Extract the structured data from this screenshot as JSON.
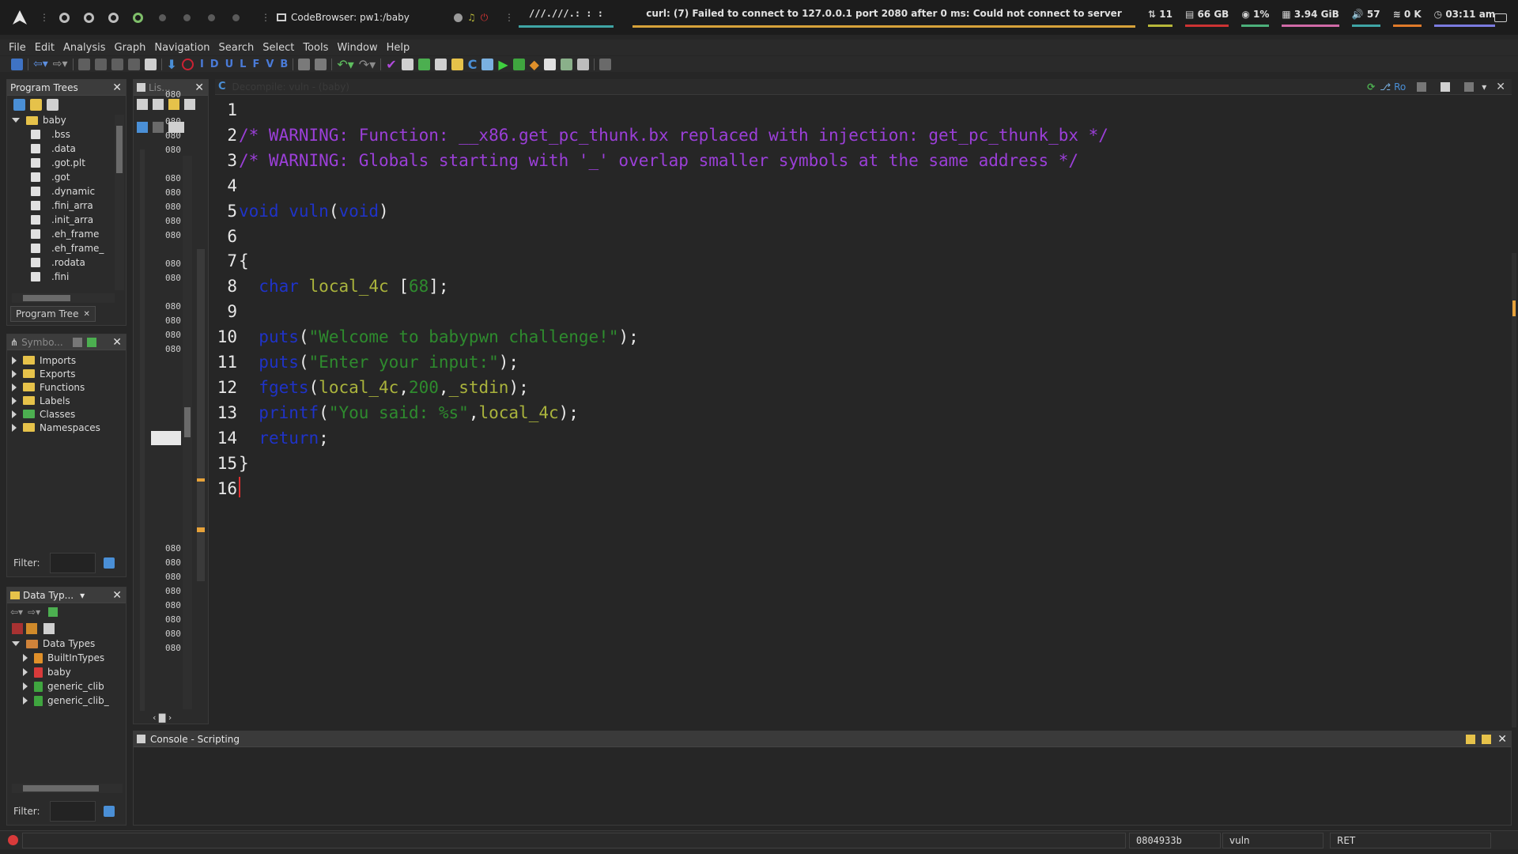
{
  "sysbar": {
    "logo_icon": "arch-logo-icon",
    "window_title": "CodeBrowser: pw1:/baby",
    "path_text": "///.///.:  : :",
    "notification": "curl: (7) Failed to connect to 127.0.0.1 port 2080 after 0 ms: Could not connect to server",
    "modules": [
      {
        "icon": "updates-icon",
        "glyph": "⇅",
        "value": "11",
        "color": "#b8b83a"
      },
      {
        "icon": "disk-icon",
        "glyph": "▤",
        "value": "66 GB",
        "color": "#cc3333"
      },
      {
        "icon": "cpu-icon",
        "glyph": "◉",
        "value": "1%",
        "color": "#4caf7a"
      },
      {
        "icon": "memory-icon",
        "glyph": "▦",
        "value": "3.94 GiB",
        "color": "#d06aa6"
      },
      {
        "icon": "volume-icon",
        "glyph": "🔊",
        "value": "57",
        "color": "#3fa5a5"
      },
      {
        "icon": "wifi-icon",
        "glyph": "≋",
        "value": "0 K",
        "color": "#e07a2a"
      },
      {
        "icon": "clock-icon",
        "glyph": "◷",
        "value": "03:11 am",
        "color": "#7b7be0"
      }
    ]
  },
  "menu": [
    "File",
    "Edit",
    "Analysis",
    "Graph",
    "Navigation",
    "Search",
    "Select",
    "Tools",
    "Window",
    "Help"
  ],
  "toolbar": {
    "letters": [
      {
        "t": "I",
        "c": "#4a7bd8"
      },
      {
        "t": "D",
        "c": "#4a7bd8"
      },
      {
        "t": "U",
        "c": "#4a7bd8"
      },
      {
        "t": "L",
        "c": "#4a7bd8"
      },
      {
        "t": "F",
        "c": "#4a7bd8"
      },
      {
        "t": "V",
        "c": "#4a7bd8"
      },
      {
        "t": "B",
        "c": "#4a7bd8"
      }
    ]
  },
  "program_trees": {
    "title": "Program Trees",
    "root": "baby",
    "items": [
      ".bss",
      ".data",
      ".got.plt",
      ".got",
      ".dynamic",
      ".fini_arra",
      ".init_arra",
      ".eh_frame",
      ".eh_frame_",
      ".rodata",
      ".fini"
    ],
    "tab": "Program Tree"
  },
  "symbol_tree": {
    "title": "Symbo...",
    "items": [
      "Imports",
      "Exports",
      "Functions",
      "Labels",
      "Classes",
      "Namespaces"
    ],
    "filter_label": "Filter:"
  },
  "data_types": {
    "title": "Data Typ...",
    "root": "Data Types",
    "items": [
      "BuiltInTypes",
      "baby",
      "generic_clib",
      "generic_clib_"
    ],
    "filter_label": "Filter:"
  },
  "listing": {
    "title": "Lis...",
    "addr_prefix": "080"
  },
  "decompiler": {
    "title": "Decompile: vuln - (baby)",
    "toolbar_label": "Ro",
    "lines": [
      {
        "n": "1",
        "parts": []
      },
      {
        "n": "2",
        "parts": [
          {
            "c": "cmt",
            "t": "/* WARNING: Function: __x86.get_pc_thunk.bx replaced with injection: get_pc_thunk_bx */"
          }
        ]
      },
      {
        "n": "3",
        "parts": [
          {
            "c": "cmt",
            "t": "/* WARNING: Globals starting with '_' overlap smaller symbols at the same address */"
          }
        ]
      },
      {
        "n": "4",
        "parts": []
      },
      {
        "n": "5",
        "parts": [
          {
            "c": "kw",
            "t": "void"
          },
          {
            "c": "pl",
            "t": " "
          },
          {
            "c": "kw",
            "t": "vuln"
          },
          {
            "c": "pl",
            "t": "("
          },
          {
            "c": "kw",
            "t": "void"
          },
          {
            "c": "pl",
            "t": ")"
          }
        ]
      },
      {
        "n": "6",
        "parts": []
      },
      {
        "n": "7",
        "parts": [
          {
            "c": "pl",
            "t": "{"
          }
        ]
      },
      {
        "n": "8",
        "parts": [
          {
            "c": "pl",
            "t": "  "
          },
          {
            "c": "kw",
            "t": "char"
          },
          {
            "c": "pl",
            "t": " "
          },
          {
            "c": "id",
            "t": "local_4c"
          },
          {
            "c": "pl",
            "t": " ["
          },
          {
            "c": "num",
            "t": "68"
          },
          {
            "c": "pl",
            "t": "];"
          }
        ]
      },
      {
        "n": "9",
        "parts": []
      },
      {
        "n": "10",
        "parts": [
          {
            "c": "pl",
            "t": "  "
          },
          {
            "c": "kw",
            "t": "puts"
          },
          {
            "c": "pl",
            "t": "("
          },
          {
            "c": "str",
            "t": "\"Welcome to babypwn challenge!\""
          },
          {
            "c": "pl",
            "t": ");"
          }
        ]
      },
      {
        "n": "11",
        "parts": [
          {
            "c": "pl",
            "t": "  "
          },
          {
            "c": "kw",
            "t": "puts"
          },
          {
            "c": "pl",
            "t": "("
          },
          {
            "c": "str",
            "t": "\"Enter your input:\""
          },
          {
            "c": "pl",
            "t": ");"
          }
        ]
      },
      {
        "n": "12",
        "parts": [
          {
            "c": "pl",
            "t": "  "
          },
          {
            "c": "kw",
            "t": "fgets"
          },
          {
            "c": "pl",
            "t": "("
          },
          {
            "c": "id",
            "t": "local_4c"
          },
          {
            "c": "pl",
            "t": ","
          },
          {
            "c": "num",
            "t": "200"
          },
          {
            "c": "pl",
            "t": ","
          },
          {
            "c": "id",
            "t": "_stdin"
          },
          {
            "c": "pl",
            "t": ");"
          }
        ]
      },
      {
        "n": "13",
        "parts": [
          {
            "c": "pl",
            "t": "  "
          },
          {
            "c": "kw",
            "t": "printf"
          },
          {
            "c": "pl",
            "t": "("
          },
          {
            "c": "str",
            "t": "\"You said: %s\""
          },
          {
            "c": "pl",
            "t": ","
          },
          {
            "c": "id",
            "t": "local_4c"
          },
          {
            "c": "pl",
            "t": ");"
          }
        ]
      },
      {
        "n": "14",
        "parts": [
          {
            "c": "pl",
            "t": "  "
          },
          {
            "c": "kw",
            "t": "return"
          },
          {
            "c": "pl",
            "t": ";"
          }
        ]
      },
      {
        "n": "15",
        "parts": [
          {
            "c": "pl",
            "t": "}"
          }
        ]
      },
      {
        "n": "16",
        "parts": [
          {
            "c": "cursor",
            "t": ""
          }
        ]
      }
    ]
  },
  "console": {
    "title": "Console - Scripting"
  },
  "status": {
    "address": "0804933b",
    "function": "vuln",
    "instruction": "RET"
  }
}
